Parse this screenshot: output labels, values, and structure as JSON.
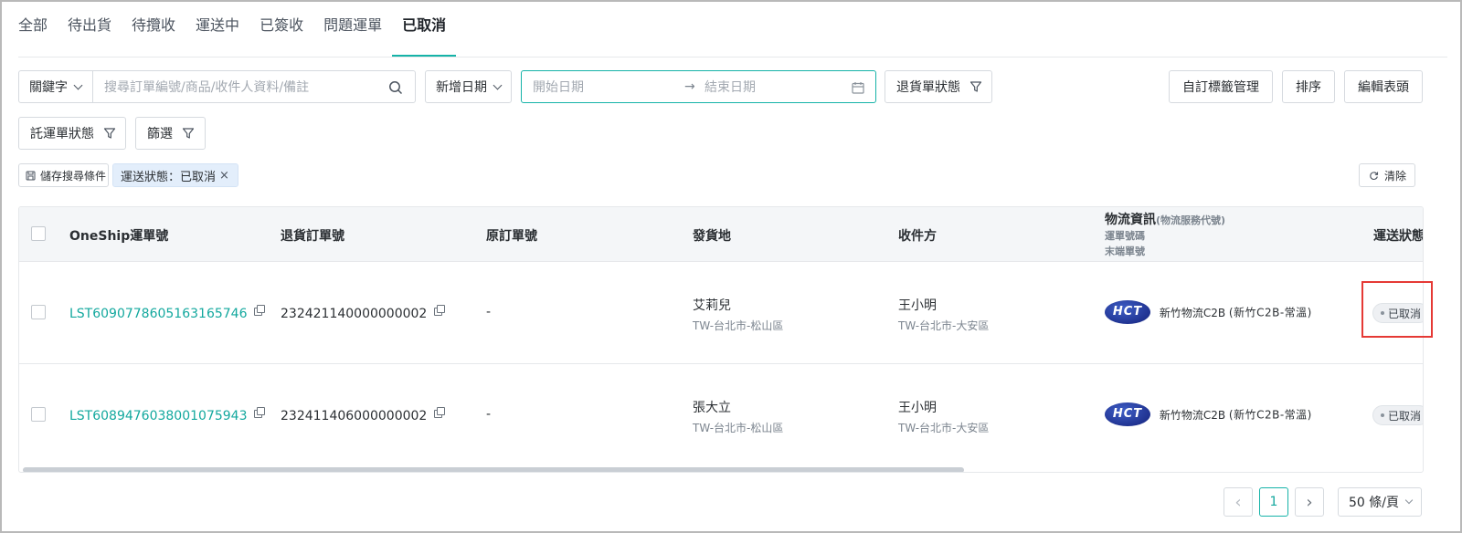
{
  "tabs": [
    "全部",
    "待出貨",
    "待攬收",
    "運送中",
    "已簽收",
    "問題運單",
    "已取消"
  ],
  "active_tab": "已取消",
  "filters": {
    "keyword_select": "關鍵字",
    "search_placeholder": "搜尋訂單編號/商品/收件人資料/備註",
    "date_type": "新增日期",
    "start_date_placeholder": "開始日期",
    "end_date_placeholder": "結束日期",
    "date_arrow": "→",
    "return_status": "退貨單狀態",
    "custom_tags": "自訂標籤管理",
    "sort": "排序",
    "edit_columns": "編輯表頭",
    "consignment_status": "託運單狀態",
    "filter": "篩選"
  },
  "chips": {
    "save_search": "儲存搜尋條件",
    "active_filter": "運送狀態：已取消",
    "remove": "×",
    "clear": "清除"
  },
  "table": {
    "headers": {
      "oneship_no": "OneShip運單號",
      "return_order_no": "退貨訂單號",
      "original_order_no": "原訂單號",
      "origin": "發貨地",
      "recipient": "收件方",
      "logistics": "物流資訊",
      "logistics_code": "(物流服務代號)",
      "waybill_code": "運單號碼",
      "last_mile_no": "末端單號",
      "shipping_status": "運送狀態"
    },
    "rows": [
      {
        "oneship_no": "LST6090778605163165746",
        "return_order_no": "232421140000000002",
        "original_order_no": "-",
        "sender_name": "艾莉兒",
        "sender_region": "TW-台北市-松山區",
        "recipient_name": "王小明",
        "recipient_region": "TW-台北市-大安區",
        "carrier_logo": "HCT",
        "carrier": "新竹物流C2B",
        "carrier_service": "(新竹C2B-常溫)",
        "status": "已取消"
      },
      {
        "oneship_no": "LST6089476038001075943",
        "return_order_no": "232411406000000002",
        "original_order_no": "-",
        "sender_name": "張大立",
        "sender_region": "TW-台北市-松山區",
        "recipient_name": "王小明",
        "recipient_region": "TW-台北市-大安區",
        "carrier_logo": "HCT",
        "carrier": "新竹物流C2B",
        "carrier_service": "(新竹C2B-常溫)",
        "status": "已取消"
      }
    ]
  },
  "pagination": {
    "prev": "‹",
    "current_page": "1",
    "next": "›",
    "page_size": "50 條/頁"
  },
  "colors": {
    "accent": "#13a89e",
    "highlight_box": "#e53935"
  }
}
